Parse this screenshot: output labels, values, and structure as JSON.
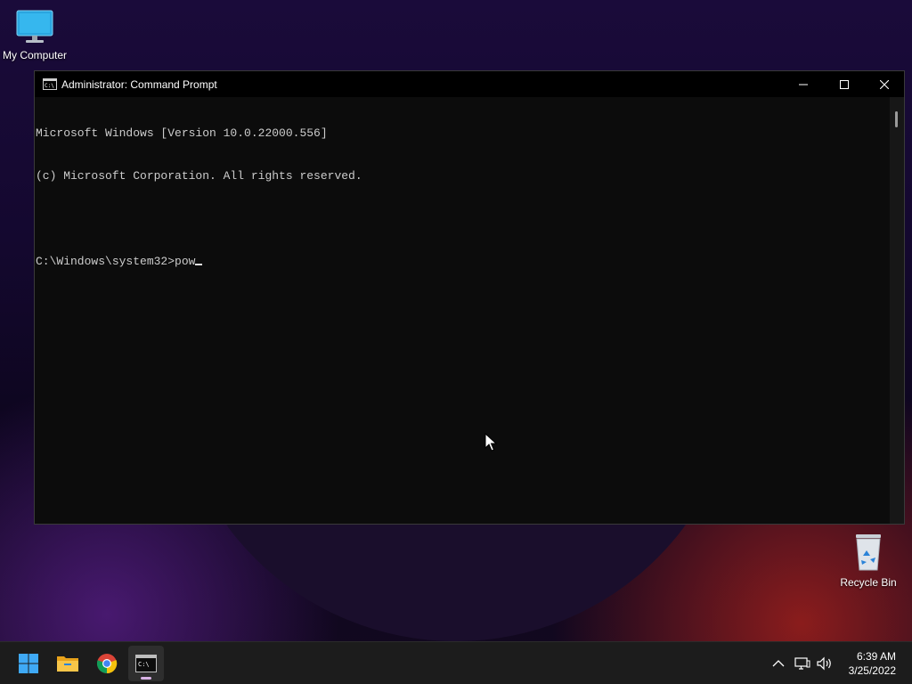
{
  "desktop": {
    "icons": [
      {
        "label": "My Computer",
        "icon": "monitor-icon"
      },
      {
        "label": "Recycle Bin",
        "icon": "recycle-bin-icon"
      }
    ]
  },
  "window": {
    "title": "Administrator: Command Prompt",
    "icon": "cmd-icon",
    "controls": [
      "minimize-icon",
      "maximize-icon",
      "close-icon"
    ]
  },
  "terminal": {
    "lines": [
      "Microsoft Windows [Version 10.0.22000.556]",
      "(c) Microsoft Corporation. All rights reserved.",
      "",
      "C:\\Windows\\system32>pow"
    ]
  },
  "taskbar": {
    "apps": [
      {
        "name": "Start",
        "icon": "windows-start-icon",
        "active": false
      },
      {
        "name": "File Explorer",
        "icon": "folder-icon",
        "active": false
      },
      {
        "name": "Google Chrome",
        "icon": "chrome-icon",
        "active": false
      },
      {
        "name": "Command Prompt",
        "icon": "terminal-icon",
        "active": true
      }
    ],
    "tray": [
      "chevron-up-icon",
      "network-icon",
      "volume-icon"
    ],
    "time": "6:39 AM",
    "date": "3/25/2022"
  },
  "colors": {
    "terminal_bg": "#0c0c0c",
    "terminal_text": "#cccccc",
    "taskbar_bg": "#1c1c1c",
    "accent_indicator": "#d9b3e6"
  }
}
